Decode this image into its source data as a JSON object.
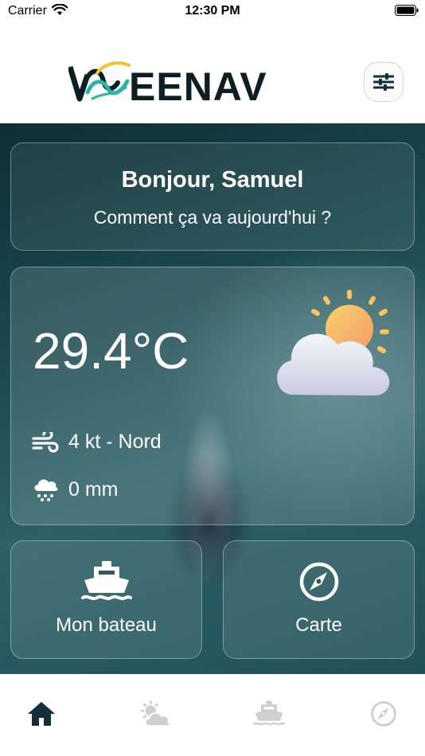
{
  "status_bar": {
    "carrier": "Carrier",
    "time": "12:30 PM"
  },
  "header": {
    "logo": {
      "text": "WEENAV",
      "accent_colors": [
        "#f2c230",
        "#2bb5a8"
      ],
      "text_color": "#0d1f24"
    },
    "settings_icon": "sliders-icon"
  },
  "greeting": {
    "title": "Bonjour, Samuel",
    "subtitle": "Comment ça va aujourd'hui ?"
  },
  "weather": {
    "temperature": "29.4°C",
    "condition_icon": "partly-cloudy-icon",
    "wind": "4 kt - Nord",
    "wind_icon": "wind-icon",
    "precipitation": "0 mm",
    "precipitation_icon": "rain-cloud-icon"
  },
  "tiles": [
    {
      "label": "Mon bateau",
      "icon": "ship-icon"
    },
    {
      "label": "Carte",
      "icon": "compass-icon"
    }
  ],
  "tab_bar": {
    "tabs": [
      {
        "icon": "home-icon",
        "active": true
      },
      {
        "icon": "weather-icon",
        "active": false
      },
      {
        "icon": "ship-icon",
        "active": false
      },
      {
        "icon": "compass-icon",
        "active": false
      }
    ],
    "active_color": "#13303a",
    "inactive_color": "#cfcfcf"
  },
  "colors": {
    "background_teal": "#1b4a50",
    "card_border": "#ffffff",
    "sun": "#f7c35a"
  }
}
